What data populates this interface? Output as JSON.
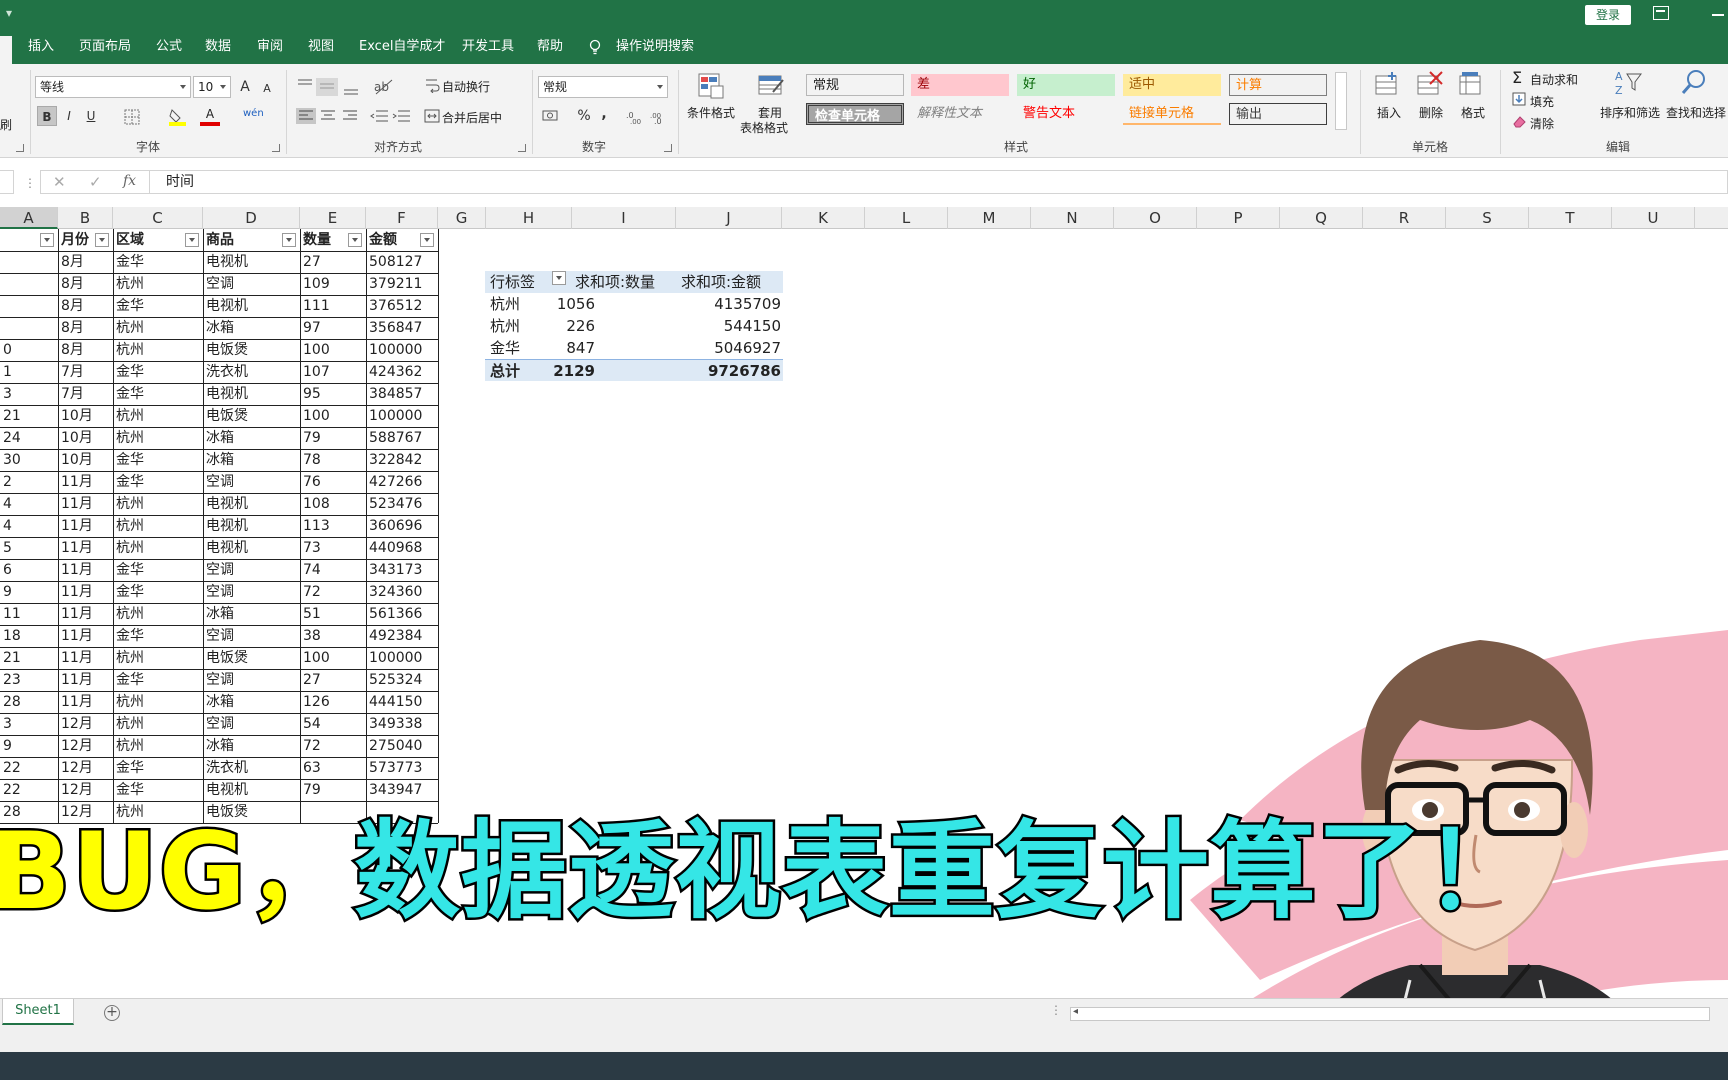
{
  "ribbon_tabs": [
    "插入",
    "页面布局",
    "公式",
    "数据",
    "审阅",
    "视图",
    "Excel自学成才",
    "开发工具",
    "帮助"
  ],
  "tell_me": "操作说明搜索",
  "login": "登录",
  "font": {
    "name": "等线",
    "size": "10",
    "bold": "B",
    "italic": "I",
    "underline": "U",
    "grow": "A",
    "shrink": "A",
    "color_letter": "A",
    "wen": "wén"
  },
  "groups": {
    "font": "字体",
    "align": "对齐方式",
    "number": "数字",
    "styles": "样式",
    "cells": "单元格",
    "edit": "编辑",
    "clip_stub": "刷"
  },
  "align": {
    "wrap": "自动换行",
    "merge": "合并后居中"
  },
  "number": {
    "format": "常规",
    "percent": "%",
    "comma": ","
  },
  "styles": {
    "cond_fmt": "条件格式",
    "table_fmt_1": "套用",
    "table_fmt_2": "表格格式",
    "cells": [
      {
        "label": "常规",
        "bg": "#ffffff",
        "color": "#000000"
      },
      {
        "label": "差",
        "bg": "#ffc7ce",
        "color": "#9c0006"
      },
      {
        "label": "好",
        "bg": "#c6efce",
        "color": "#006100"
      },
      {
        "label": "适中",
        "bg": "#ffeb9c",
        "color": "#9c5700"
      },
      {
        "label": "计算",
        "bg": "#f2f2f2",
        "color": "#fa7d00"
      },
      {
        "label": "检查单元格",
        "bg": "#a5a5a5",
        "color": "#ffffff"
      },
      {
        "label": "解释性文本",
        "bg": "#ffffff",
        "color": "#7f7f7f"
      },
      {
        "label": "警告文本",
        "bg": "#ffffff",
        "color": "#ff0000"
      },
      {
        "label": "链接单元格",
        "bg": "#ffffff",
        "color": "#fa7d00"
      },
      {
        "label": "输出",
        "bg": "#f2f2f2",
        "color": "#3f3f3f"
      }
    ]
  },
  "cells_grp": {
    "insert": "插入",
    "delete": "删除",
    "format": "格式"
  },
  "edit_grp": {
    "autosum": "自动求和",
    "fill": "填充",
    "clear": "清除",
    "sort": "排序和筛选",
    "find": "查找和选择"
  },
  "formula": {
    "value": "时间",
    "fx": "fx"
  },
  "columns": [
    "A",
    "B",
    "C",
    "D",
    "E",
    "F",
    "G",
    "H",
    "I",
    "J",
    "K",
    "L",
    "M",
    "N",
    "O",
    "P",
    "Q",
    "R",
    "S",
    "T",
    "U"
  ],
  "table": {
    "headers": [
      "",
      "月份",
      "区域",
      "商品",
      "数量",
      "金额"
    ],
    "rows": [
      [
        "",
        "8月",
        "金华",
        "电视机",
        "27",
        "508127"
      ],
      [
        "",
        "8月",
        "杭州",
        "空调",
        "109",
        "379211"
      ],
      [
        "",
        "8月",
        "金华",
        "电视机",
        "111",
        "376512"
      ],
      [
        "",
        "8月",
        "杭州",
        "冰箱",
        "97",
        "356847"
      ],
      [
        "0",
        "8月",
        "杭州",
        "电饭煲",
        "100",
        "100000"
      ],
      [
        "1",
        "7月",
        "金华",
        "洗衣机",
        "107",
        "424362"
      ],
      [
        "3",
        "7月",
        "金华",
        "电视机",
        "95",
        "384857"
      ],
      [
        "21",
        "10月",
        "杭州",
        "电饭煲",
        "100",
        "100000"
      ],
      [
        "24",
        "10月",
        "杭州",
        "冰箱",
        "79",
        "588767"
      ],
      [
        "30",
        "10月",
        "金华",
        "冰箱",
        "78",
        "322842"
      ],
      [
        "2",
        "11月",
        "金华",
        "空调",
        "76",
        "427266"
      ],
      [
        "4",
        "11月",
        "杭州",
        "电视机",
        "108",
        "523476"
      ],
      [
        "4",
        "11月",
        "杭州",
        "电视机",
        "113",
        "360696"
      ],
      [
        "5",
        "11月",
        "杭州",
        "电视机",
        "73",
        "440968"
      ],
      [
        "6",
        "11月",
        "金华",
        "空调",
        "74",
        "343173"
      ],
      [
        "9",
        "11月",
        "金华",
        "空调",
        "72",
        "324360"
      ],
      [
        "11",
        "11月",
        "杭州",
        "冰箱",
        "51",
        "561366"
      ],
      [
        "18",
        "11月",
        "金华",
        "空调",
        "38",
        "492384"
      ],
      [
        "21",
        "11月",
        "杭州",
        "电饭煲",
        "100",
        "100000"
      ],
      [
        "23",
        "11月",
        "金华",
        "空调",
        "27",
        "525324"
      ],
      [
        "28",
        "11月",
        "杭州",
        "冰箱",
        "126",
        "444150"
      ],
      [
        "3",
        "12月",
        "杭州",
        "空调",
        "54",
        "349338"
      ],
      [
        "9",
        "12月",
        "杭州",
        "冰箱",
        "72",
        "275040"
      ],
      [
        "22",
        "12月",
        "金华",
        "洗衣机",
        "63",
        "573773"
      ],
      [
        "22",
        "12月",
        "金华",
        "电视机",
        "79",
        "343947"
      ],
      [
        "28",
        "12月",
        "杭州",
        "电饭煲",
        "",
        ""
      ]
    ]
  },
  "pivot": {
    "headers": [
      "行标签",
      "求和项:数量",
      "求和项:金额"
    ],
    "rows": [
      [
        "杭州",
        "1056",
        "4135709"
      ],
      [
        "杭州",
        "226",
        "544150"
      ],
      [
        "金华",
        "847",
        "5046927"
      ]
    ],
    "total": [
      "总计",
      "2129",
      "9726786"
    ]
  },
  "caption": {
    "part_a": "BUG，",
    "part_b": "数据透视表重复计算了！"
  },
  "sheet_tab": "Sheet1",
  "add_sheet": "+"
}
